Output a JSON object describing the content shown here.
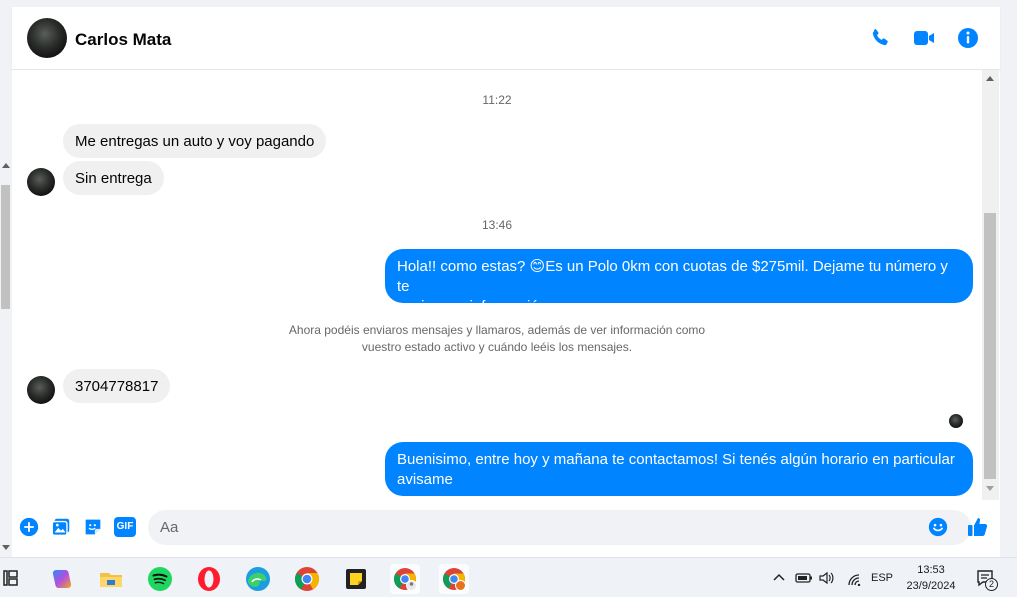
{
  "header": {
    "contact_name": "Carlos Mata",
    "icons": [
      "phone-icon",
      "video-camera-icon",
      "info-icon"
    ]
  },
  "messages": {
    "timestamp_1": "11:22",
    "incoming_1": "Me entregas un auto y voy pagando",
    "incoming_2": "Sin entrega",
    "timestamp_2": "13:46",
    "outgoing_1_line1": "Hola!! como estas? 😊Es un Polo 0km con cuotas de $275mil. Dejame tu número y te",
    "outgoing_1_line2": "envio mas información",
    "system_note_line1": "Ahora podéis enviaros mensajes y llamaros, además de ver información como",
    "system_note_line2": "vuestro estado activo y cuándo leéis los mensajes.",
    "incoming_3": "3704778817",
    "outgoing_2_line1": "Buenisimo, entre hoy y mañana te contactamos! Si tenés algún horario en particular",
    "outgoing_2_line2": "avisame"
  },
  "composer": {
    "placeholder": "Aa",
    "icons": [
      "plus-icon",
      "image-icon",
      "sticker-icon",
      "gif-icon",
      "emoji-icon",
      "thumbs-up-icon"
    ],
    "gif_label": "GIF"
  },
  "taskbar": {
    "apps": [
      "task-view-icon",
      "copilot-icon",
      "file-explorer-icon",
      "spotify-icon",
      "opera-icon",
      "edge-icon",
      "chrome-icon",
      "sticky-notes-icon",
      "chrome-profile-icon",
      "chrome-profile-2-icon"
    ],
    "language": "ESP",
    "time": "13:53",
    "date": "23/9/2024",
    "notification_count": "2"
  },
  "colors": {
    "accent": "#0084ff",
    "incoming_bubble": "#f0f0f0",
    "taskbar_active": "#c0246a"
  }
}
